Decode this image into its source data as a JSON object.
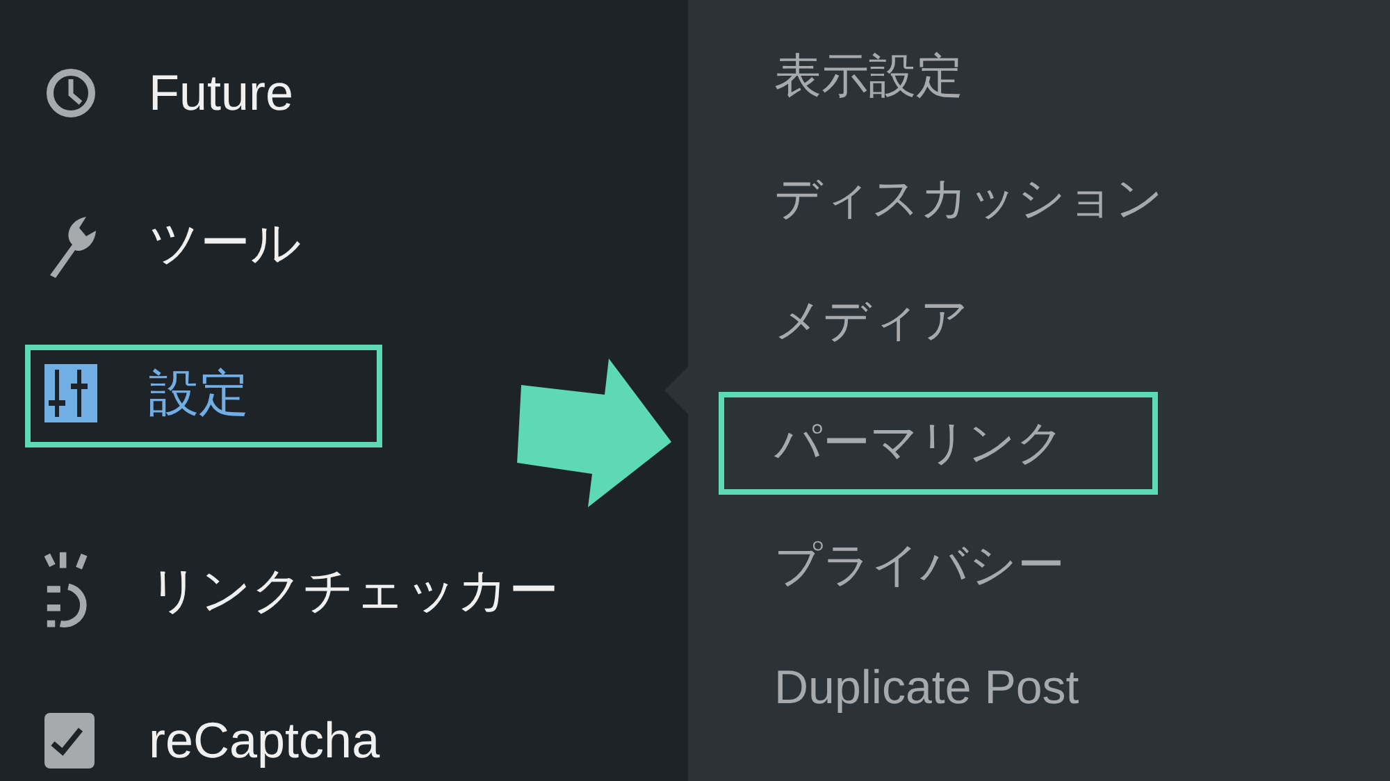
{
  "sidebar": {
    "items": [
      {
        "label": "Future",
        "selected": false,
        "highlighted": false
      },
      {
        "label": "ツール",
        "selected": false,
        "highlighted": false
      },
      {
        "label": "設定",
        "selected": true,
        "highlighted": true
      },
      {
        "label": "リンクチェッカー",
        "selected": false,
        "highlighted": false
      },
      {
        "label": "reCaptcha",
        "selected": false,
        "highlighted": false
      }
    ]
  },
  "submenu": {
    "items": [
      {
        "label": "表示設定",
        "highlighted": false
      },
      {
        "label": "ディスカッション",
        "highlighted": false
      },
      {
        "label": "メディア",
        "highlighted": false
      },
      {
        "label": "パーマリンク",
        "highlighted": true
      },
      {
        "label": "プライバシー",
        "highlighted": false
      },
      {
        "label": "Duplicate Post",
        "highlighted": false
      }
    ]
  }
}
